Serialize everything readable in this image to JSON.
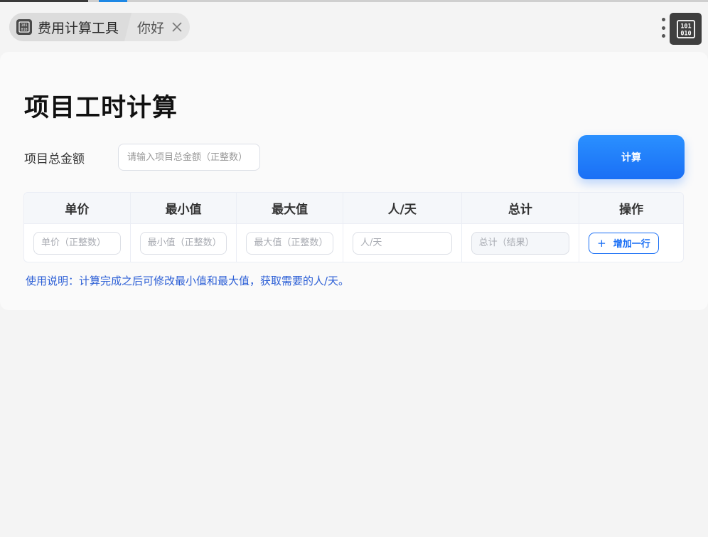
{
  "tabs": {
    "app_tab_label": "费用计算工具",
    "hello_tab_label": "你好"
  },
  "page": {
    "title": "项目工时计算",
    "total_amount_label": "项目总金额",
    "total_amount_placeholder": "请输入项目总金额（正整数）",
    "calculate_button": "计算"
  },
  "table": {
    "headers": [
      "单价",
      "最小值",
      "最大值",
      "人/天",
      "总计",
      "操作"
    ],
    "row_placeholders": {
      "unit_price": "单价（正整数）",
      "min_value": "最小值（正整数）",
      "max_value": "最大值（正整数）",
      "person_days": "人/天",
      "total": "总计（结果）"
    },
    "add_row_button": "增加一行"
  },
  "usage_note": "使用说明：计算完成之后可修改最小值和最大值，获取需要的人/天。",
  "icons": {
    "app_icon": "binary-chip-icon",
    "close": "close-icon",
    "more": "more-vertical-icon",
    "add": "plus-icon"
  },
  "colors": {
    "accent": "#1a6ff5",
    "note_text": "#2c5fd6",
    "app_icon_bg": "#3f3f3f"
  }
}
